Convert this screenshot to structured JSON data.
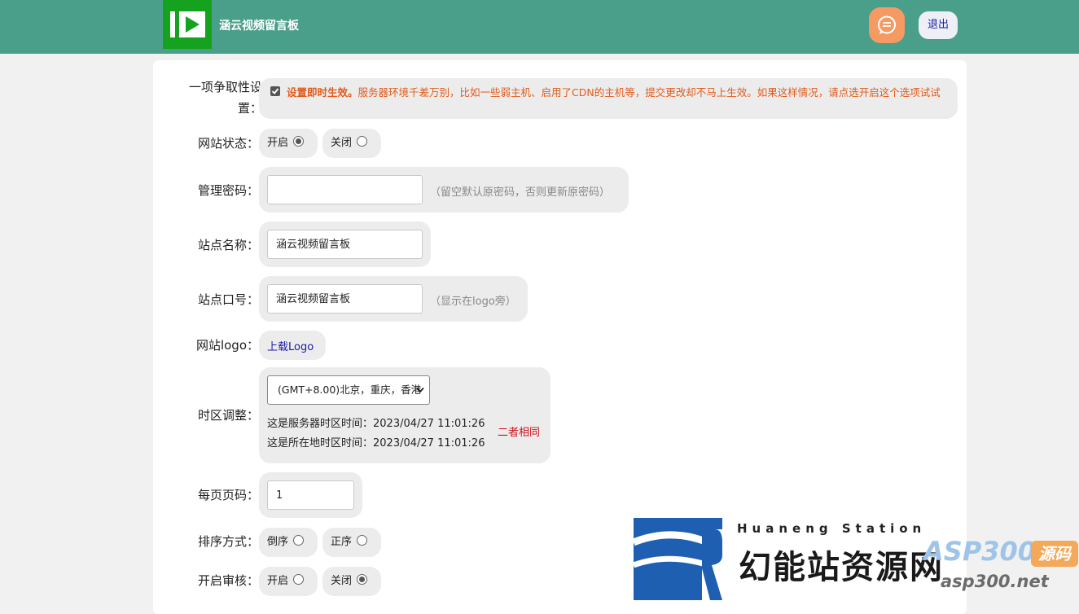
{
  "header": {
    "site_title": "涵云视频留言板",
    "logout_label": "退出",
    "message_icon": "chat-bubble-icon",
    "logo_icon": "video-play-logo-icon"
  },
  "form": {
    "aggressive": {
      "label": "一项争取性设置：",
      "checked": true,
      "bold_text": "设置即时生效。",
      "text": "服务器环境千差万别，比如一些弱主机、启用了CDN的主机等，提交更改却不马上生效。如果这样情况，请点选开启这个选项试试"
    },
    "site_status": {
      "label": "网站状态：",
      "options": [
        {
          "label": "开启",
          "checked": true
        },
        {
          "label": "关闭",
          "checked": false
        }
      ]
    },
    "admin_password": {
      "label": "管理密码：",
      "value": "",
      "hint": "（留空默认原密码，否则更新原密码）"
    },
    "site_name": {
      "label": "站点名称：",
      "value": "涵云视频留言板"
    },
    "site_slogan": {
      "label": "站点口号：",
      "value": "涵云视频留言板",
      "hint": "（显示在logo旁）"
    },
    "site_logo": {
      "label": "网站logo：",
      "link": "上载Logo"
    },
    "timezone": {
      "label": "时区调整：",
      "selected": "(GMT+8.00)北京，重庆，香港",
      "server_time_label": "这是服务器时区时间：",
      "server_time": "2023/04/27 11:01:26",
      "local_time_label": "这是所在地时区时间：",
      "local_time": "2023/04/27 11:01:26",
      "compare": "二者相同"
    },
    "per_page": {
      "label": "每页页码：",
      "value": "1"
    },
    "sort": {
      "label": "排序方式：",
      "options": [
        {
          "label": "倒序",
          "checked": false
        },
        {
          "label": "正序",
          "checked": false
        }
      ]
    },
    "review": {
      "label": "开启审核：",
      "options": [
        {
          "label": "开启",
          "checked": false
        },
        {
          "label": "关闭",
          "checked": true
        }
      ]
    }
  },
  "badge": {
    "en": "Huaneng Station",
    "cn": "幻能站资源网",
    "brand": "ASP300",
    "brand_tag": "源码",
    "url": "asp300.net"
  },
  "colors": {
    "header_bg": "#4a9f8a",
    "logo_green": "#15a21f",
    "warning_orange": "#e35a1a",
    "same_red": "#d0101a",
    "link_blue": "#1a1aa6"
  }
}
